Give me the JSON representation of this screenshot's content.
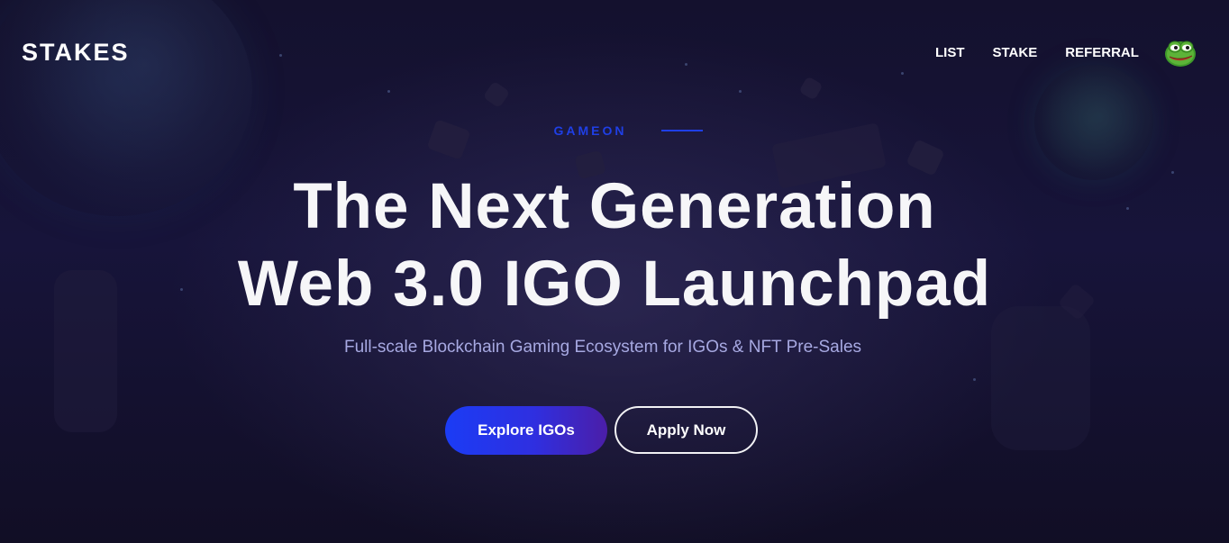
{
  "brand": {
    "logo_text": "STAKES"
  },
  "nav": {
    "items": [
      {
        "label": "LIST"
      },
      {
        "label": "STAKE"
      },
      {
        "label": "REFERRAL"
      }
    ],
    "avatar_icon": "pepe-frog-avatar-icon"
  },
  "hero": {
    "eyebrow": "GAMEON",
    "headline_line1": "The Next Generation",
    "headline_line2": "Web 3.0 IGO Launchpad",
    "subtitle": "Full-scale Blockchain Gaming Ecosystem for IGOs & NFT Pre-Sales",
    "primary_button": "Explore IGOs",
    "secondary_button": "Apply Now"
  },
  "colors": {
    "background": "#120f2a",
    "accent": "#1f3fe6",
    "subtitle": "#a7a9e2",
    "button_gradient_start": "#1b3cf5",
    "button_gradient_end": "#4b1ea8"
  }
}
